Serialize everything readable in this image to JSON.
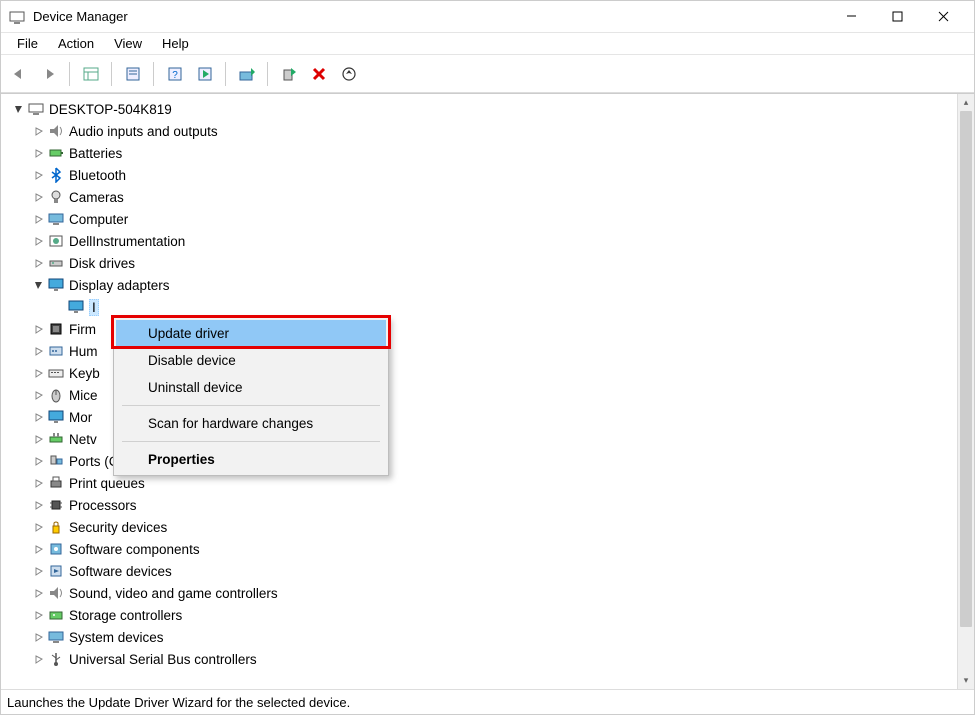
{
  "window": {
    "title": "Device Manager"
  },
  "menubar": {
    "items": [
      "File",
      "Action",
      "View",
      "Help"
    ]
  },
  "toolbar": {
    "buttons": [
      {
        "name": "back-button"
      },
      {
        "name": "forward-button"
      },
      {
        "name": "show-hide-tree-button"
      },
      {
        "name": "help-button"
      },
      {
        "name": "properties-button"
      },
      {
        "name": "update-driver-button"
      },
      {
        "name": "uninstall-device-button"
      },
      {
        "name": "disable-device-button"
      },
      {
        "name": "delete-button"
      },
      {
        "name": "scan-hardware-button"
      }
    ]
  },
  "tree": {
    "root": {
      "label": "DESKTOP-504K819",
      "expanded": true
    },
    "nodes": [
      {
        "label": "Audio inputs and outputs",
        "icon": "audio-icon",
        "expanded": false
      },
      {
        "label": "Batteries",
        "icon": "battery-icon",
        "expanded": false
      },
      {
        "label": "Bluetooth",
        "icon": "bluetooth-icon",
        "expanded": false
      },
      {
        "label": "Cameras",
        "icon": "camera-icon",
        "expanded": false
      },
      {
        "label": "Computer",
        "icon": "computer-icon",
        "expanded": false
      },
      {
        "label": "DellInstrumentation",
        "icon": "dell-icon",
        "expanded": false
      },
      {
        "label": "Disk drives",
        "icon": "disk-icon",
        "expanded": false
      },
      {
        "label": "Display adapters",
        "icon": "display-icon",
        "expanded": true,
        "children": [
          {
            "label": "I",
            "icon": "display-icon",
            "selected": true
          }
        ]
      },
      {
        "label": "Firm",
        "icon": "firmware-icon",
        "expanded": false,
        "clipped": true
      },
      {
        "label": "Hum",
        "icon": "hid-icon",
        "expanded": false,
        "clipped": true
      },
      {
        "label": "Keyb",
        "icon": "keyboard-icon",
        "expanded": false,
        "clipped": true
      },
      {
        "label": "Mice",
        "icon": "mouse-icon",
        "expanded": false,
        "clipped": true
      },
      {
        "label": "Mor",
        "icon": "monitor-icon",
        "expanded": false,
        "clipped": true
      },
      {
        "label": "Netv",
        "icon": "network-icon",
        "expanded": false,
        "clipped": true
      },
      {
        "label": "Ports (COM & LPT)",
        "icon": "ports-icon",
        "expanded": false
      },
      {
        "label": "Print queues",
        "icon": "printer-icon",
        "expanded": false
      },
      {
        "label": "Processors",
        "icon": "cpu-icon",
        "expanded": false
      },
      {
        "label": "Security devices",
        "icon": "security-icon",
        "expanded": false
      },
      {
        "label": "Software components",
        "icon": "software-comp-icon",
        "expanded": false
      },
      {
        "label": "Software devices",
        "icon": "software-dev-icon",
        "expanded": false
      },
      {
        "label": "Sound, video and game controllers",
        "icon": "sound-icon",
        "expanded": false
      },
      {
        "label": "Storage controllers",
        "icon": "storage-icon",
        "expanded": false
      },
      {
        "label": "System devices",
        "icon": "system-icon",
        "expanded": false
      },
      {
        "label": "Universal Serial Bus controllers",
        "icon": "usb-icon",
        "expanded": false,
        "cutoff": true
      }
    ]
  },
  "context_menu": {
    "items": [
      {
        "label": "Update driver",
        "highlighted": true
      },
      {
        "label": "Disable device"
      },
      {
        "label": "Uninstall device"
      },
      {
        "sep": true
      },
      {
        "label": "Scan for hardware changes"
      },
      {
        "sep": true
      },
      {
        "label": "Properties",
        "bold": true
      }
    ]
  },
  "statusbar": {
    "text": "Launches the Update Driver Wizard for the selected device."
  }
}
